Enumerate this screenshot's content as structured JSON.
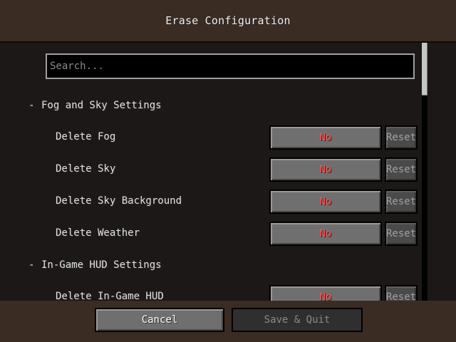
{
  "window": {
    "title": "Erase Configuration"
  },
  "search": {
    "placeholder": "Search...",
    "value": ""
  },
  "sections": [
    {
      "toggle": "-",
      "title": "Fog and Sky Settings",
      "options": [
        {
          "label": "Delete Fog",
          "value": "No",
          "reset": "Reset"
        },
        {
          "label": "Delete Sky",
          "value": "No",
          "reset": "Reset"
        },
        {
          "label": "Delete Sky Background",
          "value": "No",
          "reset": "Reset"
        },
        {
          "label": "Delete Weather",
          "value": "No",
          "reset": "Reset"
        }
      ]
    },
    {
      "toggle": "-",
      "title": "In-Game HUD Settings",
      "options": [
        {
          "label": "Delete In-Game HUD",
          "value": "No",
          "reset": "Reset"
        }
      ]
    }
  ],
  "footer": {
    "cancel_label": "Cancel",
    "save_label": "Save & Quit"
  },
  "colors": {
    "value_off": "#ff5555",
    "panel_bg": "#1c1817",
    "dirt_bg": "#3b2d24"
  }
}
